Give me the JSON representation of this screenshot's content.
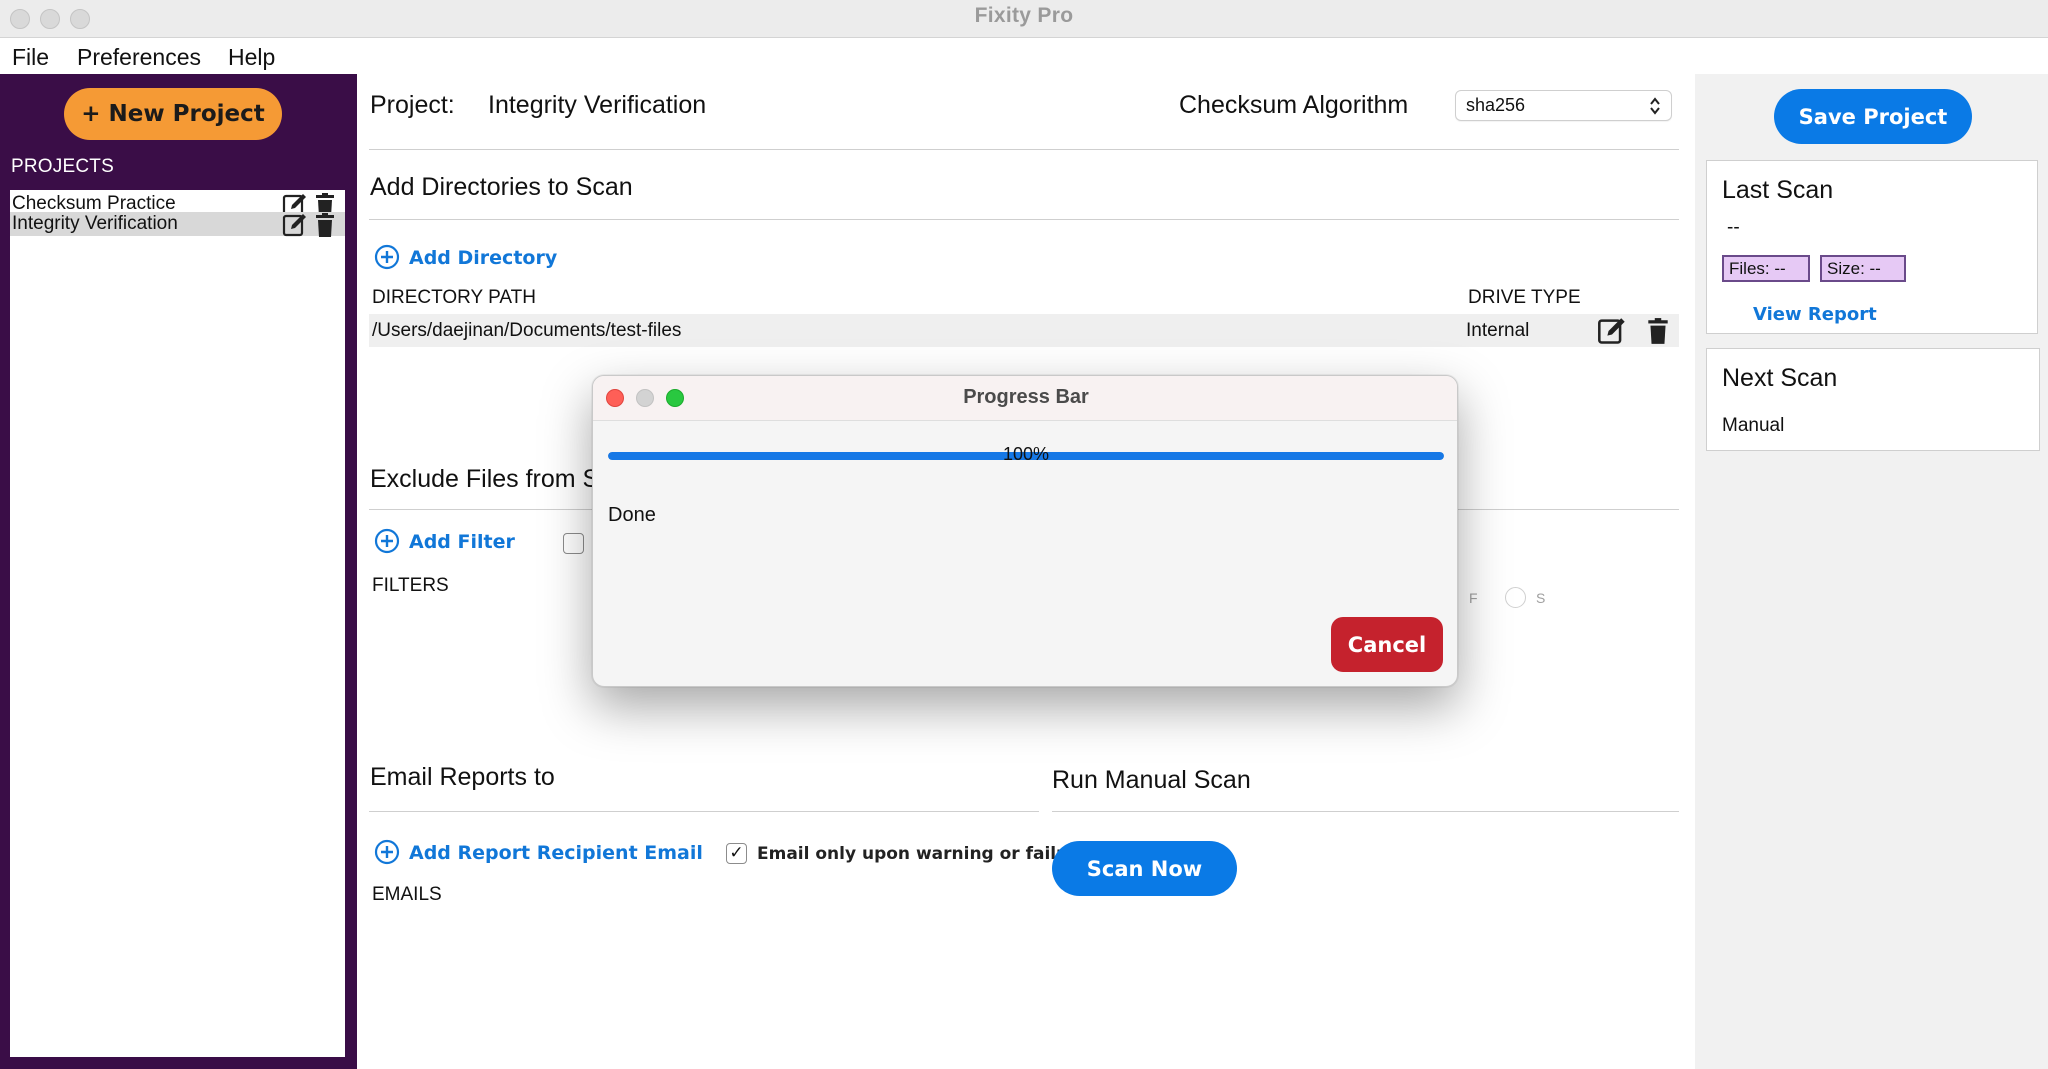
{
  "window": {
    "title": "Fixity Pro"
  },
  "menu": {
    "file": "File",
    "preferences": "Preferences",
    "help": "Help"
  },
  "sidebar": {
    "new_project": "+ New Project",
    "projects_label": "PROJECTS",
    "projects": [
      {
        "name": "Checksum Practice"
      },
      {
        "name": "Integrity Verification"
      }
    ]
  },
  "project": {
    "label": "Project:",
    "name": "Integrity Verification",
    "checksum_label": "Checksum Algorithm",
    "checksum_value": "sha256"
  },
  "directories": {
    "heading": "Add Directories to Scan",
    "add_label": "Add Directory",
    "col_path": "DIRECTORY PATH",
    "col_drive": "DRIVE TYPE",
    "rows": [
      {
        "path": "/Users/daejinan/Documents/test-files",
        "drive": "Internal"
      }
    ]
  },
  "exclude": {
    "heading": "Exclude Files from Sc",
    "add_label": "Add Filter",
    "filters_label": "FILTERS"
  },
  "email": {
    "heading": "Email Reports to",
    "add_label": "Add Report Recipient Email",
    "checkbox_label": "Email only upon warning or failure",
    "checked_mark": "✓",
    "emails_label": "EMAILS"
  },
  "manual_scan": {
    "heading": "Run Manual Scan",
    "button": "Scan Now"
  },
  "right": {
    "save": "Save Project",
    "last_scan": {
      "title": "Last Scan",
      "value": "--",
      "files": "Files: --",
      "size": "Size: --",
      "view_report": "View Report"
    },
    "next_scan": {
      "title": "Next Scan",
      "value": "Manual"
    }
  },
  "hidden_bits": {
    "f": "F",
    "s": "S"
  },
  "modal": {
    "title": "Progress Bar",
    "percent_text": "100%",
    "progress": 1.0,
    "status": "Done",
    "cancel": "Cancel"
  },
  "colors": {
    "sidebar_bg": "#3a0d47",
    "new_project": "#f59a35",
    "accent_blue": "#0a7ae6",
    "cancel_red": "#c5222d",
    "chip_bg": "#e6c9f5"
  }
}
